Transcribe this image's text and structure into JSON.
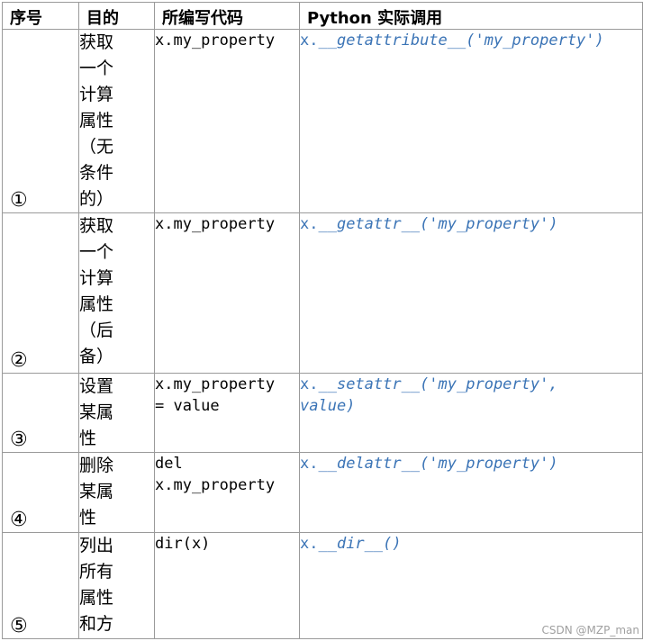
{
  "headers": [
    "序号",
    "目的",
    "所编写代码",
    "Python 实际调用"
  ],
  "rows": [
    {
      "num": "①",
      "purpose": [
        "获取",
        "一个",
        "计算",
        "属性",
        "（无",
        "条件",
        "的）"
      ],
      "code": [
        "x.my_property"
      ],
      "call": [
        [
          "x.",
          "__getattribute__('my_property')"
        ]
      ]
    },
    {
      "num": "②",
      "purpose": [
        "获取",
        "一个",
        "计算",
        "属性",
        "（后",
        "备）"
      ],
      "code": [
        "x.my_property"
      ],
      "call": [
        [
          "x.",
          "__getattr__('my_property')"
        ]
      ]
    },
    {
      "num": "③",
      "purpose": [
        "设置",
        "某属",
        "性"
      ],
      "code": [
        "x.my_property",
        "= value"
      ],
      "call": [
        [
          "x.",
          "__setattr__('my_property',"
        ],
        [
          "",
          "value)"
        ]
      ]
    },
    {
      "num": "④",
      "purpose": [
        "删除",
        "某属",
        "性"
      ],
      "code": [
        "del",
        "x.my_property"
      ],
      "call": [
        [
          "x.",
          "__delattr__('my_property')"
        ]
      ]
    },
    {
      "num": "⑤",
      "purpose": [
        "列出",
        "所有",
        "属性",
        "和方"
      ],
      "code": [
        "dir(x)"
      ],
      "call": [
        [
          "x.",
          "__dir__()"
        ]
      ]
    }
  ],
  "watermark": "CSDN @MZP_man"
}
